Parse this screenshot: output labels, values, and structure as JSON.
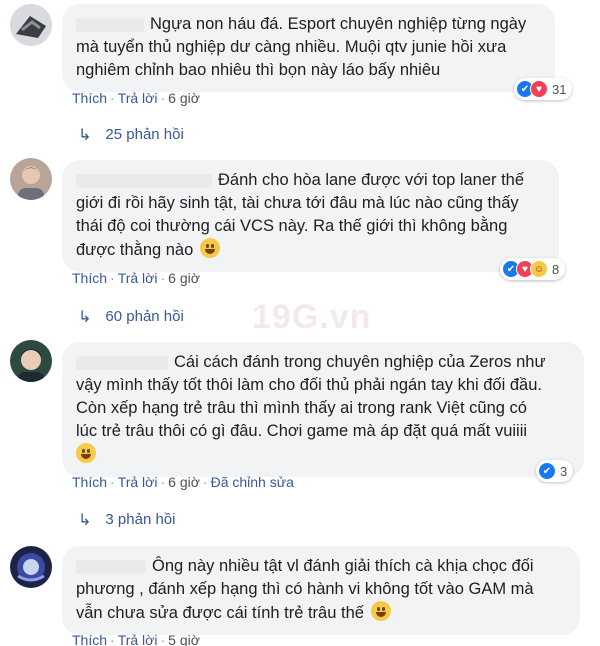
{
  "comments": [
    {
      "text_first_line": "Ngựa non háu đá. Esport chuyên nghiệp từng ngày",
      "lines": [
        "mà tuyển thủ nghiệp dư càng nhiều. Muội qtv junie hồi xưa",
        "nghiêm chỉnh bao nhiêu thì bọn này láo bấy nhiêu"
      ],
      "like": "Thích",
      "reply": "Trả lời",
      "time": "6 giờ",
      "reactions": [
        "like",
        "love"
      ],
      "reaction_count": "31",
      "replies": "25 phản hồi"
    },
    {
      "text_first_line": "Đánh cho hòa lane được với top laner thế",
      "lines": [
        "giới đi rồi hãy sinh tật, tài chưa tới đâu mà lúc nào cũng thấy",
        "thái độ coi thường cái VCS này. Ra thế giới thì không bằng",
        "được thằng nào"
      ],
      "like": "Thích",
      "reply": "Trả lời",
      "time": "6 giờ",
      "reactions": [
        "like",
        "love",
        "haha"
      ],
      "reaction_count": "8",
      "replies": "60 phản hồi"
    },
    {
      "text_first_line": "Cái cách đánh trong chuyên nghiệp của Zeros như",
      "lines": [
        "vậy mình thấy tốt thôi làm cho đối thủ phải ngán tay khi đối đầu.",
        "Còn xếp hạng trẻ trâu thì mình thấy ai trong rank Việt cũng có",
        "lúc trẻ trâu thôi có gì đâu. Chơi game mà áp đặt quá mất vuiiii"
      ],
      "like": "Thích",
      "reply": "Trả lời",
      "time": "6 giờ",
      "edited": "Đã chỉnh sửa",
      "reactions": [
        "like"
      ],
      "reaction_count": "3",
      "replies": "3 phản hồi"
    },
    {
      "text_first_line": "Ông này nhiều tật vl đánh giải thích cà khịa chọc đối",
      "lines": [
        "phương , đánh xếp hạng thì có hành vi không tốt vào GAM mà",
        "vẫn chưa sửa được cái tính trẻ trâu thế"
      ],
      "like": "Thích",
      "reply": "Trả lời",
      "time": "5 giờ"
    }
  ],
  "watermark": "19G.vn",
  "colors": {
    "link": "#385898",
    "bubble": "#f2f3f5",
    "like": "#1877f2",
    "love": "#f33e58",
    "haha": "#f7c948"
  }
}
